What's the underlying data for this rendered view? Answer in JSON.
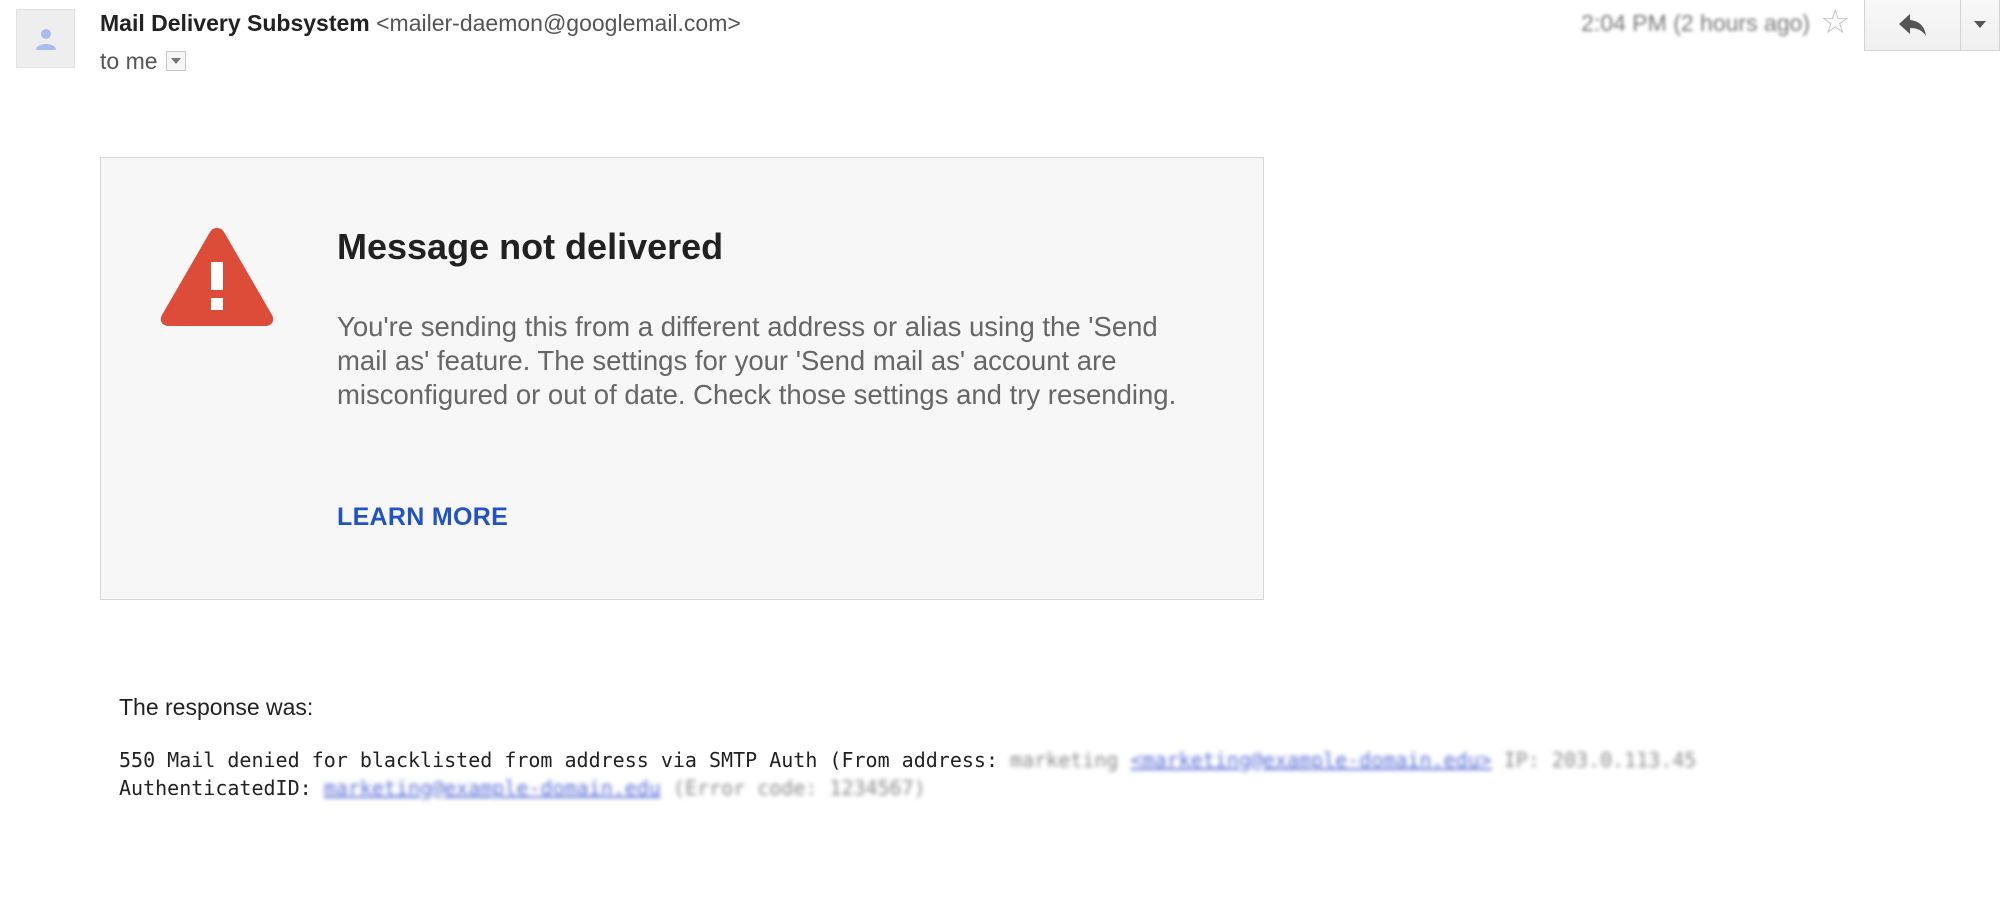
{
  "header": {
    "sender_name": "Mail Delivery Subsystem",
    "sender_email": "<mailer-daemon@googlemail.com>",
    "to_text": "to me",
    "date_text": "2:04 PM (2 hours ago)",
    "reply_icon": "reply-icon",
    "more_icon": "chevron-down-icon",
    "star_icon": "star-icon",
    "avatar_icon": "person-icon"
  },
  "card": {
    "icon": "warning-icon",
    "title": "Message not delivered",
    "body": "You're sending this from a different address or alias using the 'Send mail as' feature. The settings for your 'Send mail as' account are misconfigured or out of date. Check those settings and try resending.",
    "learn_more": "LEARN MORE",
    "warning_color": "#dd4b39",
    "link_color": "#2253c4"
  },
  "response": {
    "label": "The response was:",
    "line1_prefix": "550 Mail denied for blacklisted from address via SMTP Auth (From address: ",
    "line1_name": "marketing ",
    "line1_email": "<marketing@example-domain.edu>",
    "line1_suffix": " IP: 203.0.113.45",
    "line2_prefix": "AuthenticatedID: ",
    "line2_link": "marketing@example-domain.edu",
    "line2_suffix": " (Error code: 1234567)"
  }
}
